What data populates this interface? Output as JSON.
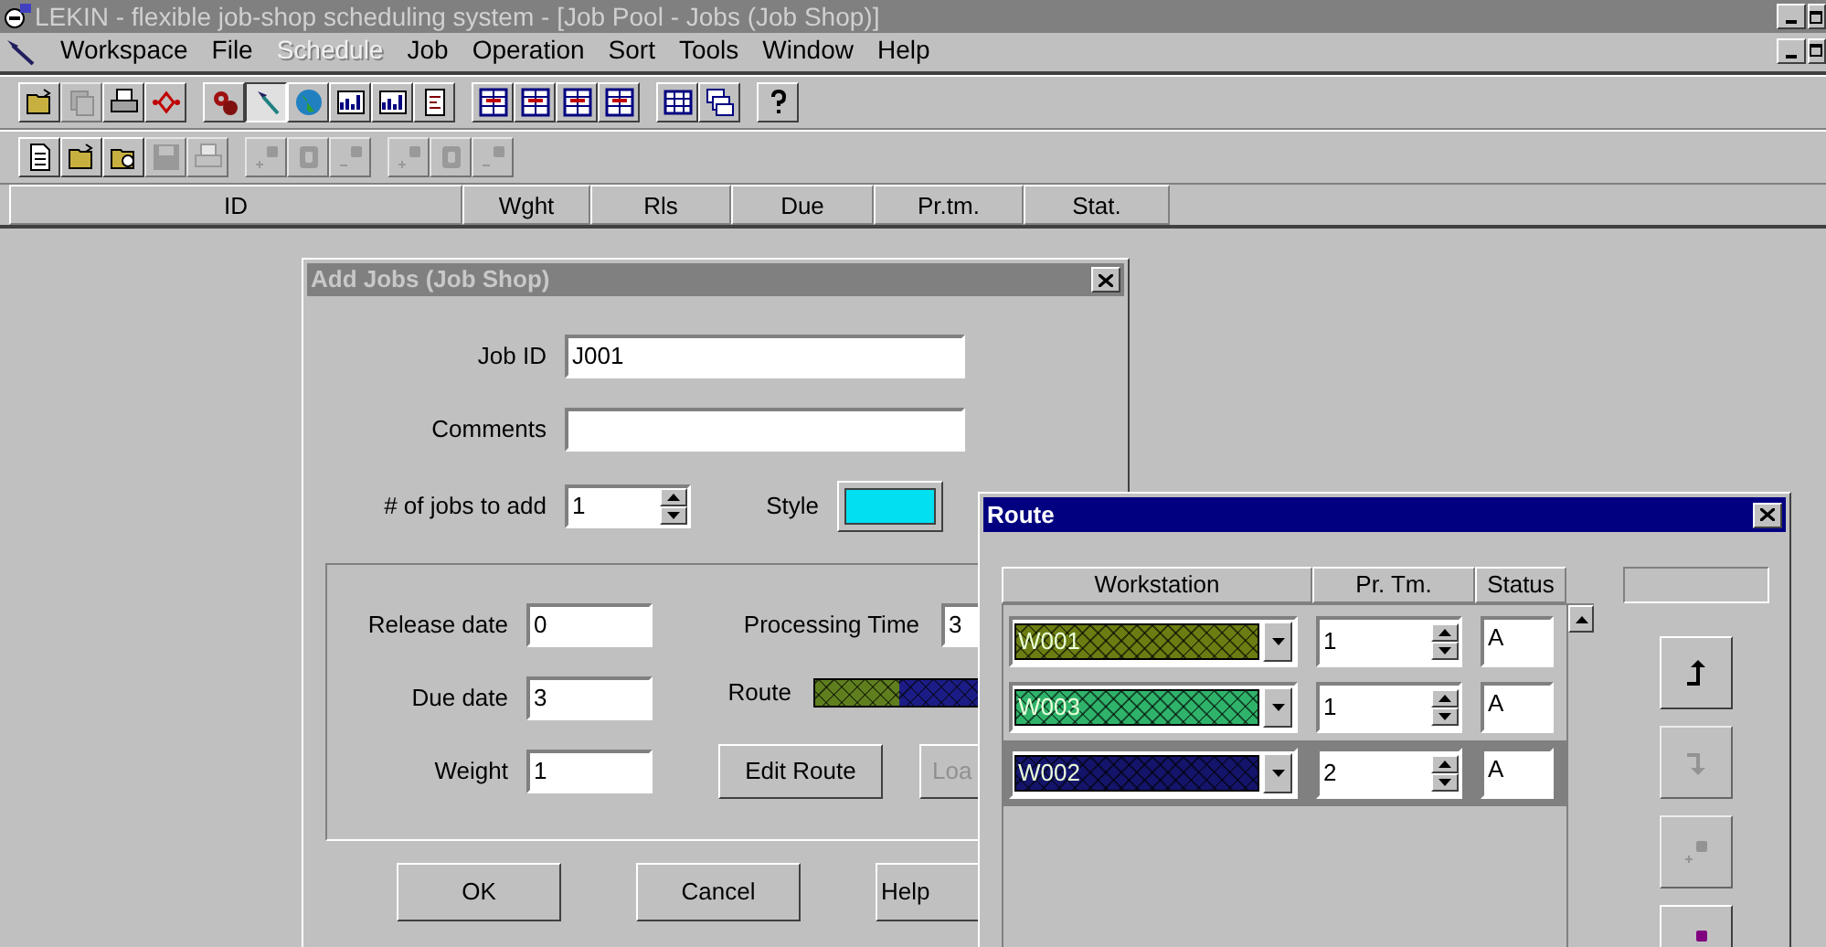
{
  "window": {
    "title": "LEKIN - flexible job-shop scheduling system - [Job Pool - Jobs (Job Shop)]"
  },
  "menu": [
    {
      "label": "Workspace",
      "disabled": false
    },
    {
      "label": "File",
      "disabled": false
    },
    {
      "label": "Schedule",
      "disabled": true
    },
    {
      "label": "Job",
      "disabled": false
    },
    {
      "label": "Operation",
      "disabled": false
    },
    {
      "label": "Sort",
      "disabled": false
    },
    {
      "label": "Tools",
      "disabled": false
    },
    {
      "label": "Window",
      "disabled": false
    },
    {
      "label": "Help",
      "disabled": false
    }
  ],
  "toolbar_1": [
    [
      {
        "kind": "open",
        "disabled": false,
        "pressed": false
      },
      {
        "kind": "copy",
        "disabled": true,
        "pressed": false
      },
      {
        "kind": "print",
        "disabled": false,
        "pressed": false
      },
      {
        "kind": "diamond",
        "disabled": false,
        "pressed": false
      }
    ],
    [
      {
        "kind": "gears",
        "disabled": false,
        "pressed": false
      },
      {
        "kind": "hammer",
        "disabled": false,
        "pressed": true
      },
      {
        "kind": "globe",
        "disabled": false,
        "pressed": false
      },
      {
        "kind": "chart",
        "disabled": false,
        "pressed": false
      },
      {
        "kind": "chart",
        "disabled": false,
        "pressed": false
      },
      {
        "kind": "document",
        "disabled": false,
        "pressed": false
      }
    ],
    [
      {
        "kind": "table",
        "disabled": false,
        "pressed": false
      },
      {
        "kind": "table",
        "disabled": false,
        "pressed": false
      },
      {
        "kind": "table",
        "disabled": false,
        "pressed": false
      },
      {
        "kind": "table",
        "disabled": false,
        "pressed": false
      }
    ],
    [
      {
        "kind": "grid",
        "disabled": false,
        "pressed": false
      },
      {
        "kind": "windows",
        "disabled": false,
        "pressed": false
      }
    ],
    [
      {
        "kind": "question",
        "disabled": false,
        "pressed": false
      }
    ]
  ],
  "toolbar_2": [
    [
      {
        "kind": "new",
        "disabled": false,
        "pressed": false
      },
      {
        "kind": "open",
        "disabled": false,
        "pressed": false
      },
      {
        "kind": "folder-plus",
        "disabled": false,
        "pressed": false
      },
      {
        "kind": "save",
        "disabled": true,
        "pressed": false
      },
      {
        "kind": "print",
        "disabled": true,
        "pressed": false
      }
    ],
    [
      {
        "kind": "add",
        "disabled": true,
        "pressed": false
      },
      {
        "kind": "badge",
        "disabled": true,
        "pressed": false
      },
      {
        "kind": "remove",
        "disabled": true,
        "pressed": false
      }
    ],
    [
      {
        "kind": "add",
        "disabled": true,
        "pressed": false
      },
      {
        "kind": "badge",
        "disabled": true,
        "pressed": false
      },
      {
        "kind": "remove",
        "disabled": true,
        "pressed": false
      }
    ]
  ],
  "columns": [
    "ID",
    "Wght",
    "Rls",
    "Due",
    "Pr.tm.",
    "Stat."
  ],
  "add_jobs": {
    "title": "Add Jobs (Job Shop)",
    "job_id": {
      "label": "Job ID",
      "value": "J001"
    },
    "comments": {
      "label": "Comments"
    },
    "jobs_to_add": {
      "label": "# of jobs to add",
      "value": "1"
    },
    "style": {
      "label": "Style",
      "color": "#00e0f0"
    },
    "release_date": {
      "label": "Release date",
      "value": "0"
    },
    "due_date": {
      "label": "Due date",
      "value": "3"
    },
    "weight": {
      "label": "Weight",
      "value": "1"
    },
    "processing_time": {
      "label": "Processing Time",
      "value": "3"
    },
    "route": {
      "label": "Route",
      "segments": [
        {
          "color": "#5f7f1f"
        },
        {
          "color": "#1c1c86"
        }
      ]
    },
    "edit_route_button": {
      "label": "Edit Route",
      "disabled": false
    },
    "load_button": {
      "label": "Loa",
      "disabled": true
    },
    "buttons": [
      {
        "label": "OK"
      },
      {
        "label": "Cancel"
      },
      {
        "label": "Help"
      }
    ]
  },
  "route_dialog": {
    "title": "Route",
    "columns": [
      "Workstation",
      "Pr. Tm.",
      "Status"
    ],
    "rows": [
      {
        "workstation": "W001",
        "color": "#6b7d12",
        "time": "1",
        "status": "A",
        "selected": false
      },
      {
        "workstation": "W003",
        "color": "#2fb36a",
        "time": "1",
        "status": "A",
        "selected": false
      },
      {
        "workstation": "W002",
        "color": "#14146b",
        "time": "2",
        "status": "A",
        "selected": true
      }
    ],
    "side_buttons": [
      {
        "kind": "move-up",
        "disabled": false
      },
      {
        "kind": "move-down",
        "disabled": true
      },
      {
        "kind": "add",
        "disabled": true
      },
      {
        "kind": "remove",
        "disabled": false
      }
    ]
  }
}
